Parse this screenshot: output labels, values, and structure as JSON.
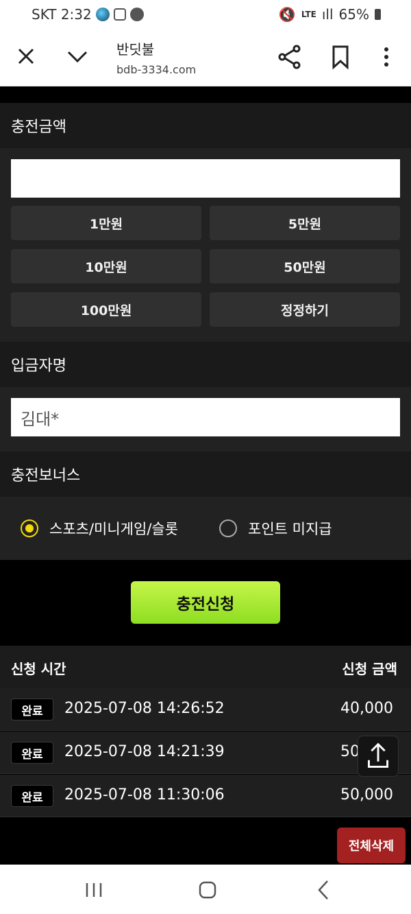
{
  "status_bar": {
    "carrier_time": "SKT 2:32",
    "network": "LTE",
    "battery": "65%"
  },
  "browser": {
    "title": "반딧불",
    "url": "bdb-3334.com"
  },
  "charge_amount": {
    "header": "충전금액",
    "input_value": "",
    "buttons": [
      "1만원",
      "5만원",
      "10만원",
      "50만원",
      "100만원",
      "정정하기"
    ]
  },
  "depositor": {
    "header": "입금자명",
    "value": "김대*"
  },
  "bonus": {
    "header": "충전보너스",
    "options": [
      {
        "label": "스포츠/미니게임/슬롯",
        "selected": true
      },
      {
        "label": "포인트 미지급",
        "selected": false
      }
    ]
  },
  "submit_label": "충전신청",
  "history": {
    "col_time": "신청 시간",
    "col_amount": "신청 금액",
    "rows": [
      {
        "status": "완료",
        "time": "2025-07-08 14:26:52",
        "amount": "40,000"
      },
      {
        "status": "완료",
        "time": "2025-07-08 14:21:39",
        "amount": "50,000"
      },
      {
        "status": "완료",
        "time": "2025-07-08 11:30:06",
        "amount": "50,000"
      }
    ]
  },
  "delete_all_label": "전체삭제",
  "colors": {
    "submit_gradient_top": "#c5f54a",
    "submit_gradient_bottom": "#8ede22",
    "radio_selected": "#f5d90a",
    "delete_button": "#a32120"
  }
}
